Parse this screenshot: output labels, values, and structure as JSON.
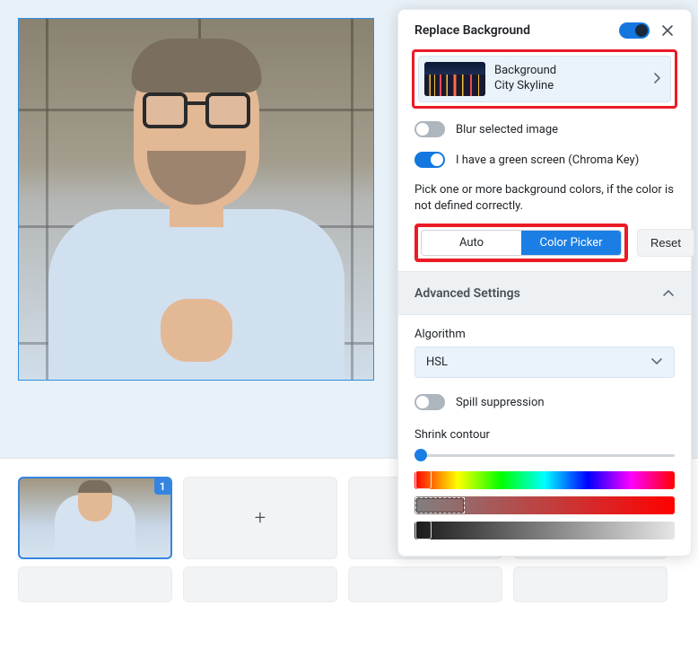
{
  "panel": {
    "title": "Replace Background",
    "background_selector": {
      "label": "Background",
      "name": "City Skyline"
    },
    "blur_label": "Blur selected image",
    "chroma_label": "I have a green screen (Chroma Key)",
    "help_text": "Pick one or more background colors, if the color is not defined correctly.",
    "mode_auto": "Auto",
    "mode_picker": "Color Picker",
    "reset": "Reset",
    "advanced_title": "Advanced Settings",
    "algorithm_label": "Algorithm",
    "algorithm_value": "HSL",
    "spill_label": "Spill suppression",
    "shrink_label": "Shrink contour"
  },
  "slides": {
    "selected_badge": "1",
    "add_symbol": "+"
  }
}
